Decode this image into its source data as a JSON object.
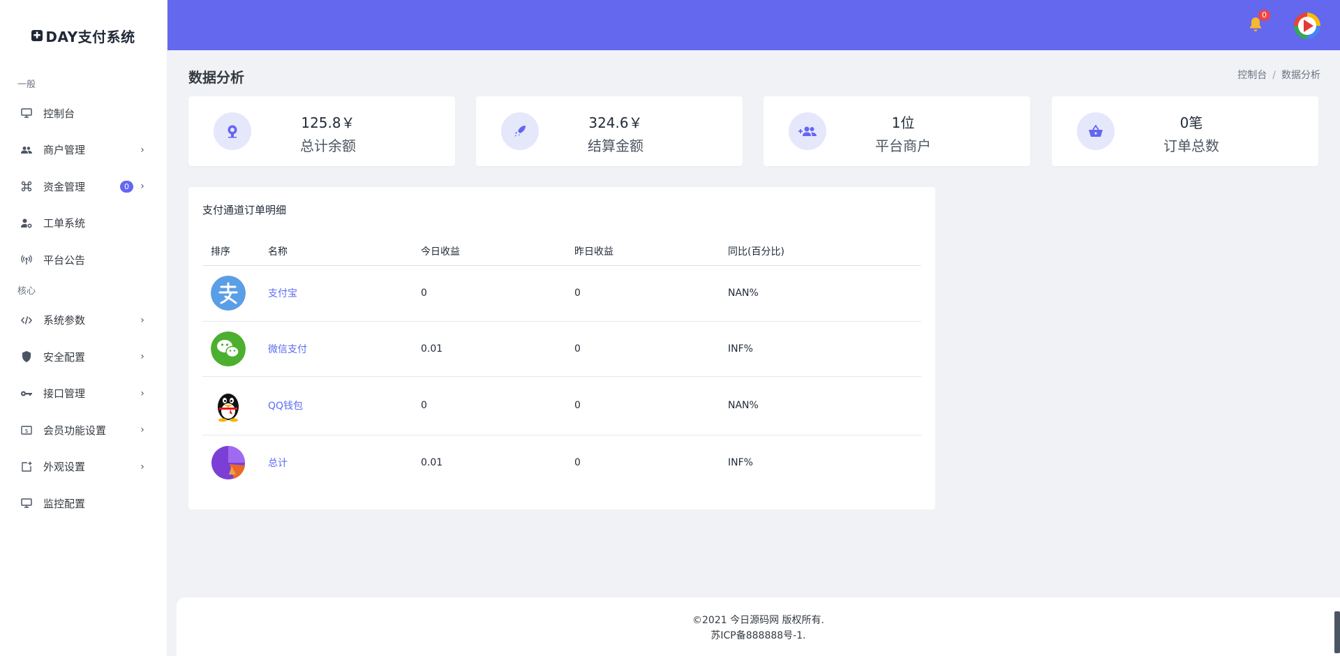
{
  "brand": {
    "name": "DAY支付系统"
  },
  "sidebar": {
    "sections": [
      {
        "title": "一般"
      },
      {
        "title": "核心"
      }
    ],
    "items": [
      {
        "label": "控制台",
        "icon": "monitor-icon"
      },
      {
        "label": "商户管理",
        "icon": "users-icon"
      },
      {
        "label": "资金管理",
        "icon": "command-icon",
        "badge": "0"
      },
      {
        "label": "工单系统",
        "icon": "user-gear-icon"
      },
      {
        "label": "平台公告",
        "icon": "broadcast-icon"
      },
      {
        "label": "系统参数",
        "icon": "code-icon"
      },
      {
        "label": "安全配置",
        "icon": "shield-icon"
      },
      {
        "label": "接口管理",
        "icon": "key-icon"
      },
      {
        "label": "会员功能设置",
        "icon": "dollar-icon"
      },
      {
        "label": "外观设置",
        "icon": "add-box-icon"
      },
      {
        "label": "监控配置",
        "icon": "monitor-icon"
      }
    ]
  },
  "topbar": {
    "notifications": "0",
    "accent": "#6468ee"
  },
  "page": {
    "title": "数据分析",
    "breadcrumb": [
      "控制台",
      "数据分析"
    ]
  },
  "stats": [
    {
      "value": "125.8￥",
      "label": "总计余额",
      "icon": "webcam-icon"
    },
    {
      "value": "324.6￥",
      "label": "结算金额",
      "icon": "rocket-icon"
    },
    {
      "value": "1位",
      "label": "平台商户",
      "icon": "user-add-icon"
    },
    {
      "value": "0笔",
      "label": "订单总数",
      "icon": "basket-icon"
    }
  ],
  "orders": {
    "title": "支付通道订单明细",
    "columns": [
      "排序",
      "名称",
      "今日收益",
      "昨日收益",
      "同比(百分比)"
    ],
    "rows": [
      {
        "name": "支付宝",
        "today": "0",
        "yesterday": "0",
        "ratio": "NAN%",
        "logo": "alipay-logo-icon"
      },
      {
        "name": "微信支付",
        "today": "0.01",
        "yesterday": "0",
        "ratio": "INF%",
        "logo": "wechat-logo-icon"
      },
      {
        "name": "QQ钱包",
        "today": "0",
        "yesterday": "0",
        "ratio": "NAN%",
        "logo": "qq-logo-icon"
      },
      {
        "name": "总计",
        "today": "0.01",
        "yesterday": "0",
        "ratio": "INF%",
        "logo": "pie-chart-icon"
      }
    ]
  },
  "footer": {
    "line1": "©2021 今日源码网 版权所有.",
    "line2": "苏ICP备888888号-1."
  }
}
